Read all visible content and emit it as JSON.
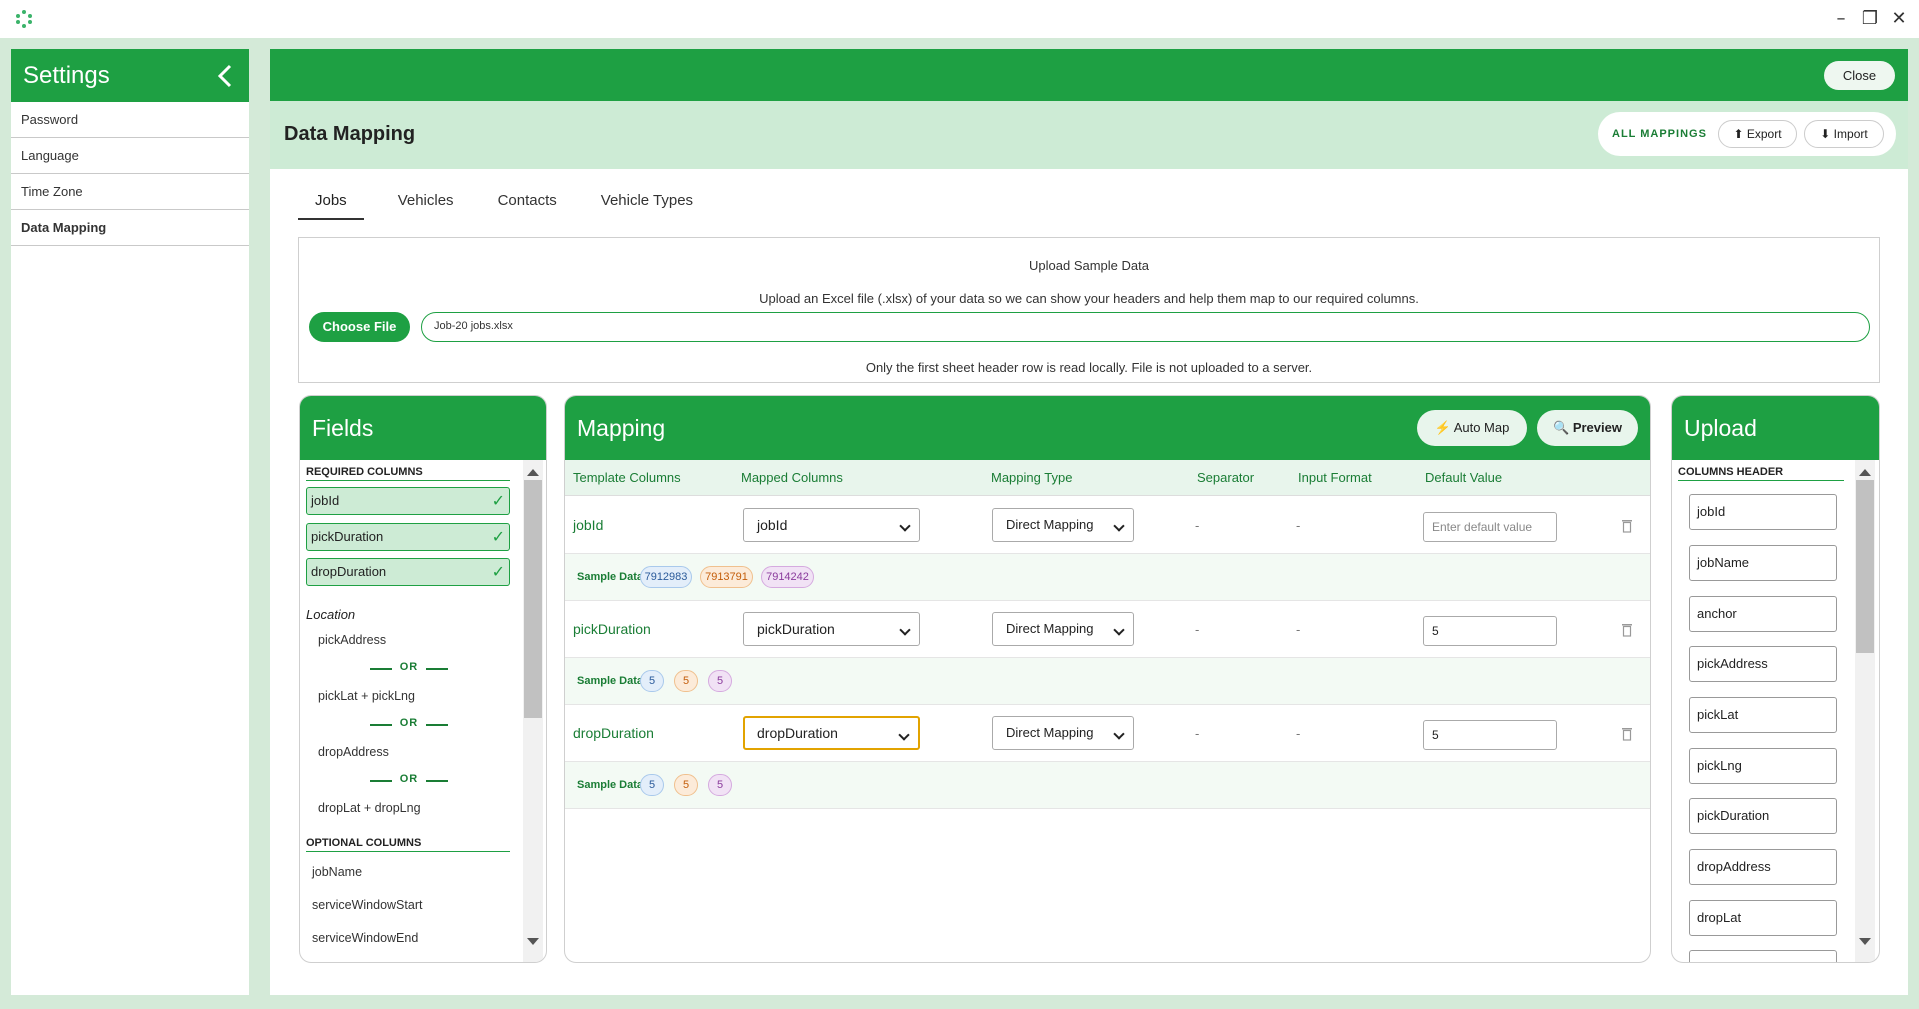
{
  "settings": {
    "title": "Settings",
    "items": [
      {
        "label": "Password"
      },
      {
        "label": "Language"
      },
      {
        "label": "Time Zone"
      },
      {
        "label": "Data Mapping"
      }
    ]
  },
  "main": {
    "close_label": "Close",
    "page_title": "Data Mapping",
    "all_mappings_label": "ALL MAPPINGS",
    "export_label": "⬆ Export",
    "import_label": "⬇ Import",
    "tabs": [
      {
        "label": "Jobs"
      },
      {
        "label": "Vehicles"
      },
      {
        "label": "Contacts"
      },
      {
        "label": "Vehicle Types"
      }
    ]
  },
  "upload_sample": {
    "title": "Upload Sample Data",
    "description": "Upload an Excel file (.xlsx) of your data so we can show your headers and help them map to our required columns.",
    "choose_file_label": "Choose File",
    "file_name": "Job-20 jobs.xlsx",
    "note": "Only the first sheet header row is read locally. File is not uploaded to a server."
  },
  "fields": {
    "title": "Fields",
    "required_label": "REQUIRED COLUMNS",
    "required": [
      "jobId",
      "pickDuration",
      "dropDuration"
    ],
    "check_glyph": "✓",
    "location_label": "Location",
    "location_options": [
      "pickAddress",
      "pickLat + pickLng",
      "dropAddress",
      "dropLat + dropLng"
    ],
    "or_label": "OR",
    "optional_label": "OPTIONAL COLUMNS",
    "optional": [
      "jobName",
      "serviceWindowStart",
      "serviceWindowEnd"
    ]
  },
  "mapping": {
    "title": "Mapping",
    "auto_map_label": "⚡ Auto Map",
    "preview_label": "🔍 Preview",
    "headers": [
      "Template Columns",
      "Mapped Columns",
      "Mapping Type",
      "Separator",
      "Input Format",
      "Default Value"
    ],
    "sample_label": "Sample Data:",
    "dash": "-",
    "default_placeholder": "Enter default value",
    "rows": [
      {
        "template": "jobId",
        "mapped": "jobId",
        "type": "Direct Mapping",
        "separator": "-",
        "input_format": "-",
        "default_value": "",
        "samples": [
          "7912983",
          "7913791",
          "7914242"
        ]
      },
      {
        "template": "pickDuration",
        "mapped": "pickDuration",
        "type": "Direct Mapping",
        "separator": "-",
        "input_format": "-",
        "default_value": "5",
        "samples": [
          "5",
          "5",
          "5"
        ]
      },
      {
        "template": "dropDuration",
        "mapped": "dropDuration",
        "type": "Direct Mapping",
        "separator": "-",
        "input_format": "-",
        "default_value": "5",
        "samples": [
          "5",
          "5",
          "5"
        ]
      }
    ]
  },
  "upload_panel": {
    "title": "Upload",
    "columns_header_label": "COLUMNS HEADER",
    "columns": [
      "jobId",
      "jobName",
      "anchor",
      "pickAddress",
      "pickLat",
      "pickLng",
      "pickDuration",
      "dropAddress",
      "dropLat",
      ""
    ]
  },
  "colors": {
    "brand_green": "#1ea043",
    "light_green": "#cdebd5",
    "focus_orange": "#e2a300"
  }
}
